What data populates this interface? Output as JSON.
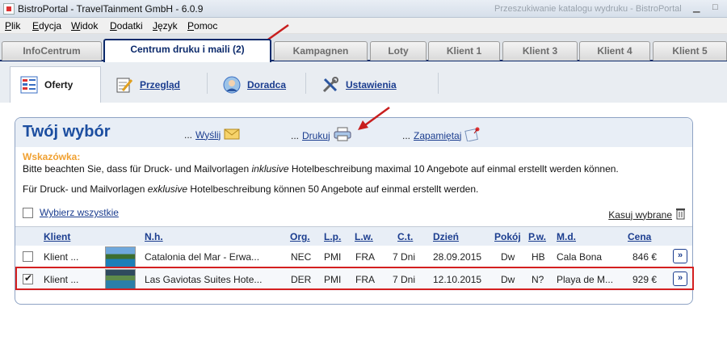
{
  "window": {
    "title": "BistroPortal - TravelTainment GmbH - 6.0.9",
    "ghost_title": "Przeszukiwanie katalogu wydruku - BistroPortal"
  },
  "menu": [
    "Plik",
    "Edycja",
    "Widok",
    "Dodatki",
    "Język",
    "Pomoc"
  ],
  "main_tabs": [
    "InfoCentrum",
    "Centrum druku i maili (2)",
    "Kampagnen",
    "Loty",
    "Klient 1",
    "Klient 3",
    "Klient 4",
    "Klient 5"
  ],
  "sub_tabs": [
    "Oferty",
    "Przegląd",
    "Doradca",
    "Ustawienia"
  ],
  "panel": {
    "title": "Twój wybór",
    "actions": [
      {
        "prefix": "...",
        "label": "Wyślij",
        "icon": "envelope-icon"
      },
      {
        "prefix": "...",
        "label": "Drukuj",
        "icon": "printer-icon"
      },
      {
        "prefix": "...",
        "label": "Zapamiętaj",
        "icon": "pin-note-icon"
      }
    ],
    "hint_label": "Wskazówka:",
    "hint_line1_a": "Bitte beachten Sie, dass für Druck- und Mailvorlagen ",
    "hint_line1_em": "inklusive",
    "hint_line1_b": " Hotelbeschreibung maximal 10 Angebote auf einmal erstellt werden können.",
    "hint_line2_a": "Für Druck- und Mailvorlagen ",
    "hint_line2_em": "exklusive",
    "hint_line2_b": " Hotelbeschreibung können 50 Angebote auf einmal erstellt werden.",
    "select_all": "Wybierz wszystkie",
    "clear_selected": "Kasuj wybrane"
  },
  "table": {
    "columns": [
      "Klient",
      "N.h.",
      "Org.",
      "L.p.",
      "L.w.",
      "C.t.",
      "Dzień",
      "Pokój",
      "P.w.",
      "M.d.",
      "Cena"
    ],
    "rows": [
      {
        "checked": false,
        "klient": "Klient ...",
        "hotel": "Catalonia del Mar - Erwa...",
        "org": "NEC",
        "lp": "PMI",
        "lw": "FRA",
        "ct": "7 Dni",
        "dzien": "28.09.2015",
        "pokoj": "Dw",
        "pw": "HB",
        "md": "Cala Bona",
        "cena": "846 €"
      },
      {
        "checked": true,
        "klient": "Klient ...",
        "hotel": "Las Gaviotas Suites Hote...",
        "org": "DER",
        "lp": "PMI",
        "lw": "FRA",
        "ct": "7 Dni",
        "dzien": "12.10.2015",
        "pokoj": "Dw",
        "pw": "N?",
        "md": "Playa de M...",
        "cena": "929 €"
      }
    ],
    "go_label": "»"
  },
  "colors": {
    "accent": "#1b3d8f",
    "title_blue": "#1c4ea0",
    "hint": "#f0a030",
    "highlight": "#d42020"
  }
}
